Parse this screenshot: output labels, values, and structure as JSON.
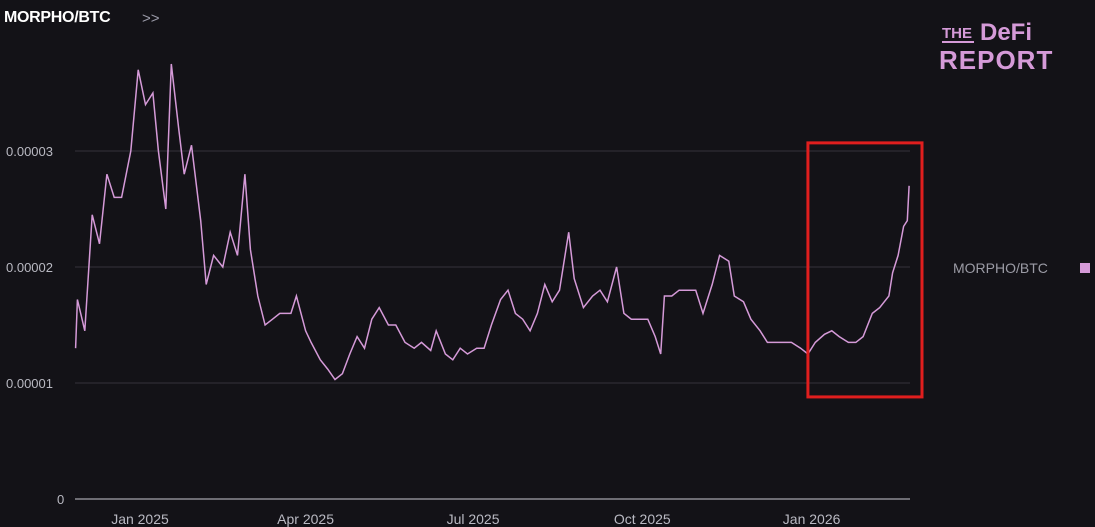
{
  "header": {
    "title": "MORPHO/BTC",
    "expand_icon": ">>"
  },
  "logo": {
    "line1a": "THE",
    "line1b": "DeFi",
    "line2": "REPORT"
  },
  "colors": {
    "line": "#d59ad8",
    "annotation": "#e01e1e",
    "grid": "#34333b",
    "background": "#131217"
  },
  "chart_data": {
    "type": "line",
    "title": "MORPHO/BTC",
    "x_unit": "days since 2025-01-01",
    "xlim": [
      -35,
      418
    ],
    "ylim": [
      0,
      4e-05
    ],
    "grid": true,
    "legend": {
      "label": "MORPHO/BTC",
      "placement": "right"
    },
    "y_ticks": [
      {
        "value": 0,
        "label": "0"
      },
      {
        "value": 1e-05,
        "label": "0.00001"
      },
      {
        "value": 2e-05,
        "label": "0.00002"
      },
      {
        "value": 3e-05,
        "label": "0.00003"
      }
    ],
    "x_ticks": [
      {
        "value": 0,
        "label": "Jan 2025"
      },
      {
        "value": 90,
        "label": "Apr 2025"
      },
      {
        "value": 181,
        "label": "Jul 2025"
      },
      {
        "value": 273,
        "label": "Oct 2025"
      },
      {
        "value": 365,
        "label": "Jan 2026"
      }
    ],
    "annotation": {
      "type": "highlight-box",
      "x_range": [
        363,
        425
      ],
      "y_range": [
        8.8e-06,
        3.07e-05
      ]
    },
    "series": [
      {
        "name": "MORPHO/BTC",
        "x": [
          -35,
          -34,
          -30,
          -26,
          -22,
          -18,
          -14,
          -10,
          -5,
          -1,
          3,
          7,
          10,
          14,
          17,
          21,
          24,
          28,
          33,
          36,
          40,
          45,
          49,
          53,
          57,
          60,
          64,
          68,
          72,
          76,
          82,
          85,
          90,
          93,
          98,
          102,
          106,
          110,
          114,
          118,
          122,
          126,
          130,
          135,
          139,
          144,
          149,
          153,
          158,
          161,
          166,
          170,
          174,
          178,
          183,
          187,
          191,
          196,
          200,
          204,
          208,
          212,
          216,
          220,
          224,
          228,
          233,
          236,
          241,
          246,
          250,
          254,
          259,
          263,
          267,
          272,
          276,
          280,
          283,
          285,
          289,
          293,
          298,
          302,
          306,
          311,
          315,
          320,
          323,
          328,
          332,
          337,
          341,
          346,
          350,
          354,
          359,
          363,
          367,
          372,
          376,
          380,
          385,
          389,
          393,
          398,
          402,
          407,
          409,
          412,
          415,
          417,
          418
        ],
        "y": [
          1.3e-05,
          1.72e-05,
          1.45e-05,
          2.45e-05,
          2.2e-05,
          2.8e-05,
          2.6e-05,
          2.6e-05,
          3e-05,
          3.7e-05,
          3.4e-05,
          3.5e-05,
          3e-05,
          2.5e-05,
          3.75e-05,
          3.2e-05,
          2.8e-05,
          3.05e-05,
          2.4e-05,
          1.85e-05,
          2.1e-05,
          2e-05,
          2.3e-05,
          2.1e-05,
          2.8e-05,
          2.15e-05,
          1.75e-05,
          1.5e-05,
          1.55e-05,
          1.6e-05,
          1.6e-05,
          1.75e-05,
          1.45e-05,
          1.35e-05,
          1.2e-05,
          1.12e-05,
          1.03e-05,
          1.08e-05,
          1.25e-05,
          1.4e-05,
          1.3e-05,
          1.55e-05,
          1.65e-05,
          1.5e-05,
          1.5e-05,
          1.35e-05,
          1.3e-05,
          1.35e-05,
          1.28e-05,
          1.45e-05,
          1.25e-05,
          1.2e-05,
          1.3e-05,
          1.25e-05,
          1.3e-05,
          1.3e-05,
          1.5e-05,
          1.72e-05,
          1.8e-05,
          1.6e-05,
          1.55e-05,
          1.45e-05,
          1.6e-05,
          1.85e-05,
          1.7e-05,
          1.8e-05,
          2.3e-05,
          1.9e-05,
          1.65e-05,
          1.75e-05,
          1.8e-05,
          1.7e-05,
          2e-05,
          1.6e-05,
          1.55e-05,
          1.55e-05,
          1.55e-05,
          1.4e-05,
          1.25e-05,
          1.75e-05,
          1.75e-05,
          1.8e-05,
          1.8e-05,
          1.8e-05,
          1.6e-05,
          1.85e-05,
          2.1e-05,
          2.05e-05,
          1.75e-05,
          1.7e-05,
          1.55e-05,
          1.45e-05,
          1.35e-05,
          1.35e-05,
          1.35e-05,
          1.35e-05,
          1.3e-05,
          1.25e-05,
          1.35e-05,
          1.42e-05,
          1.45e-05,
          1.4e-05,
          1.35e-05,
          1.35e-05,
          1.4e-05,
          1.6e-05,
          1.65e-05,
          1.75e-05,
          1.95e-05,
          2.1e-05,
          2.35e-05,
          2.4e-05,
          2.7e-05
        ]
      }
    ]
  }
}
